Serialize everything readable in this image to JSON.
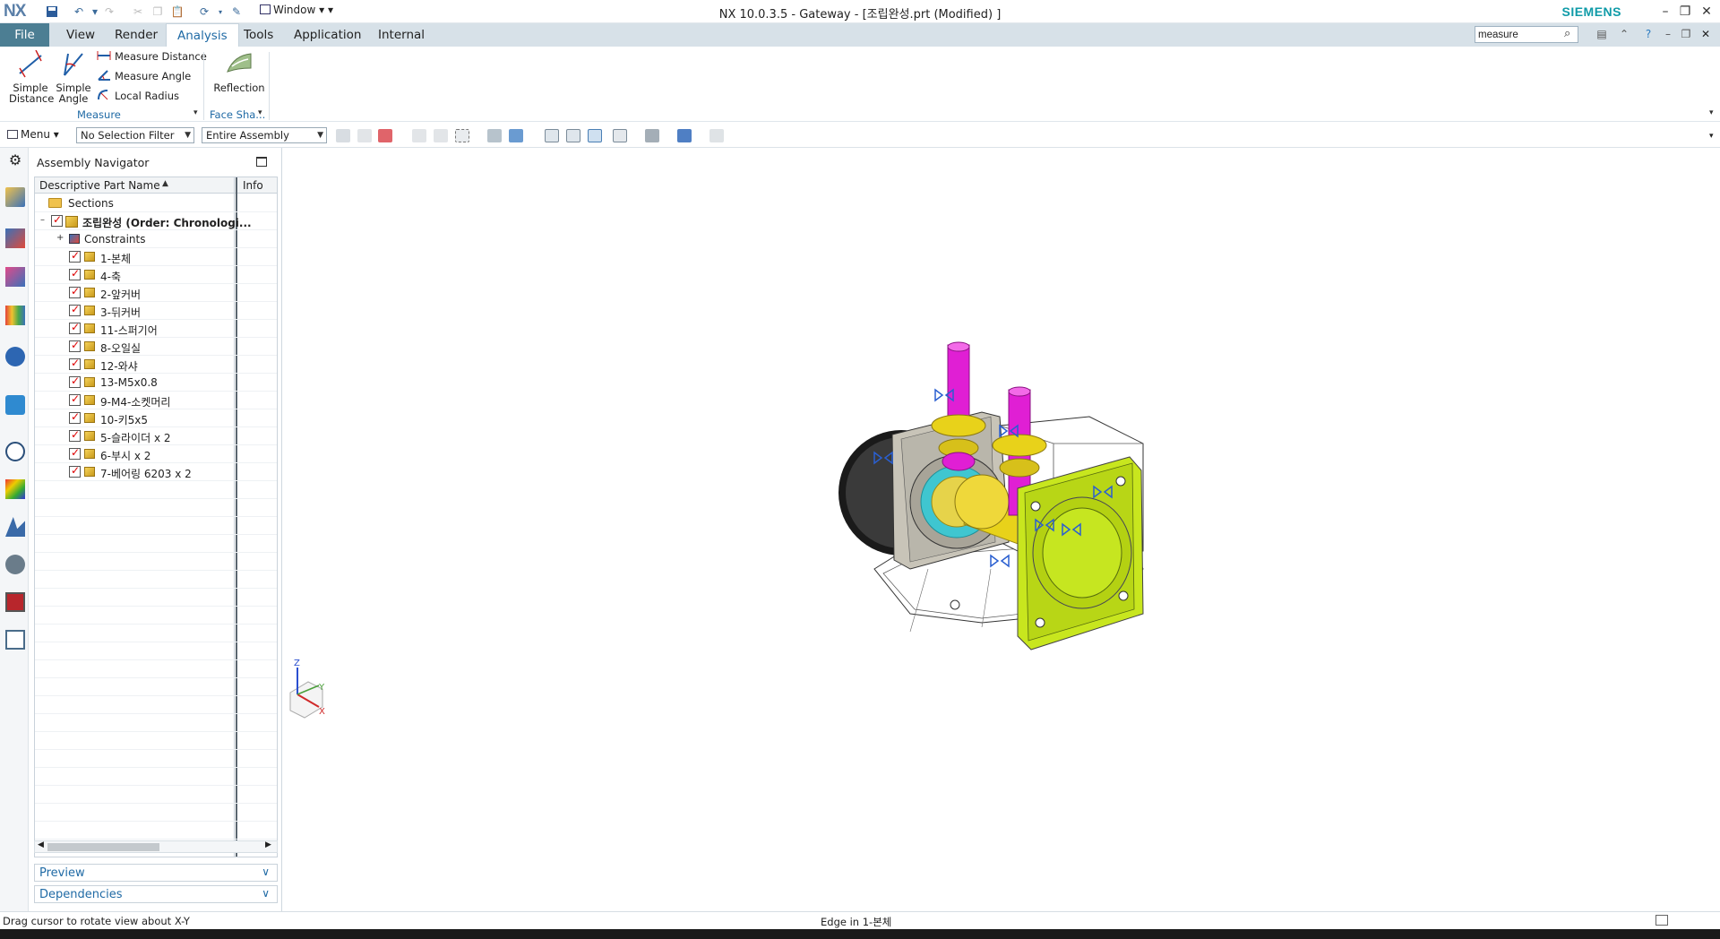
{
  "titlebar": {
    "logo": "NX",
    "window_menu": "Window",
    "title": "NX 10.0.3.5 - Gateway - [조립완성.prt (Modified) ]",
    "brand": "SIEMENS"
  },
  "tabs": {
    "file": "File",
    "view": "View",
    "render": "Render",
    "analysis": "Analysis",
    "tools": "Tools",
    "application": "Application",
    "internal": "Internal"
  },
  "search": {
    "value": "measure"
  },
  "ribbon": {
    "simple_distance": "Simple Distance",
    "simple_distance_l1": "Simple",
    "simple_distance_l2": "Distance",
    "simple_angle_l1": "Simple",
    "simple_angle_l2": "Angle",
    "measure_distance": "Measure Distance",
    "measure_angle": "Measure Angle",
    "local_radius": "Local Radius",
    "reflection": "Reflection",
    "group_measure": "Measure",
    "group_face_shape": "Face Sha..."
  },
  "toolbar": {
    "menu": "Menu",
    "selection_filter": "No Selection Filter",
    "assembly_scope": "Entire Assembly"
  },
  "navigator": {
    "title": "Assembly Navigator",
    "col_name": "Descriptive Part Name",
    "col_info": "Info",
    "sections": "Sections",
    "root": "조립완성 (Order: Chronologi...",
    "constraints": "Constraints",
    "parts": [
      "1-본체",
      "4-축",
      "2-앞커버",
      "3-뒤커버",
      "11-스퍼기어",
      "8-오일실",
      "12-와샤",
      "13-M5x0.8",
      "9-M4-소켓머리",
      "10-키5x5",
      "5-슬라이더 x 2",
      "6-부시 x 2",
      "7-베어링 6203 x 2"
    ],
    "preview": "Preview",
    "dependencies": "Dependencies"
  },
  "status": {
    "left": "Drag cursor to rotate view about X-Y",
    "middle": "Edge in 1-본체"
  },
  "triad": {
    "z": "Z",
    "y": "Y",
    "x": "X"
  },
  "colors": {
    "file_tab": "#4c7e93",
    "accent": "#1f6aa5",
    "brand": "#0f9ba8",
    "part_yellow": "#e8d21a",
    "shaft_magenta": "#e01fd4"
  }
}
